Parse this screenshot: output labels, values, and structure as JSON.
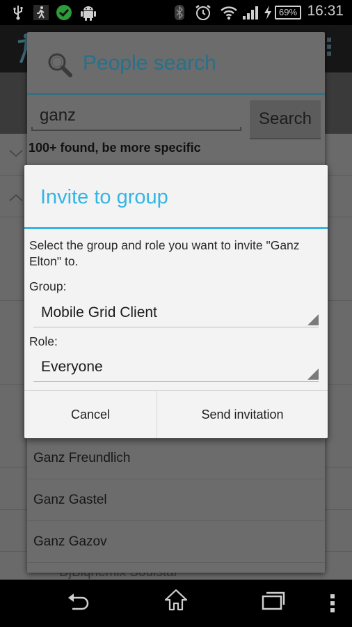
{
  "status_bar": {
    "left_icons": [
      "usb-icon",
      "accessibility-icon",
      "check-circle-icon",
      "android-icon"
    ],
    "right_icons": [
      "bluetooth-icon",
      "alarm-icon",
      "wifi-icon",
      "signal-icon",
      "charging-icon"
    ],
    "battery": "69%",
    "time": "16:31",
    "check_color": "#2e9b3a"
  },
  "background_app": {
    "rows": [
      {
        "icon": "chevron-down-icon",
        "glyph": "⌄"
      },
      {
        "icon": "chevron-up-icon",
        "glyph": "⌃"
      }
    ]
  },
  "people_search": {
    "title": "People search",
    "search_value": "ganz",
    "search_button": "Search",
    "result_count": "100+ found, be more specific",
    "results": [
      "Ganz Freundlich",
      "Ganz Gastel",
      "Ganz Gazov"
    ],
    "peek_item": "DjBiqnemix Soulstar"
  },
  "invite_dialog": {
    "title": "Invite to group",
    "message": "Select the group and role you want to invite \"Ganz Elton\" to.",
    "group_label": "Group:",
    "group_value": "Mobile Grid Client",
    "role_label": "Role:",
    "role_value": "Everyone",
    "cancel_label": "Cancel",
    "send_label": "Send invitation",
    "accent_color": "#33b5e5"
  },
  "nav_bar": {
    "buttons": [
      "back-icon",
      "home-icon",
      "recent-apps-icon",
      "menu-icon"
    ]
  }
}
